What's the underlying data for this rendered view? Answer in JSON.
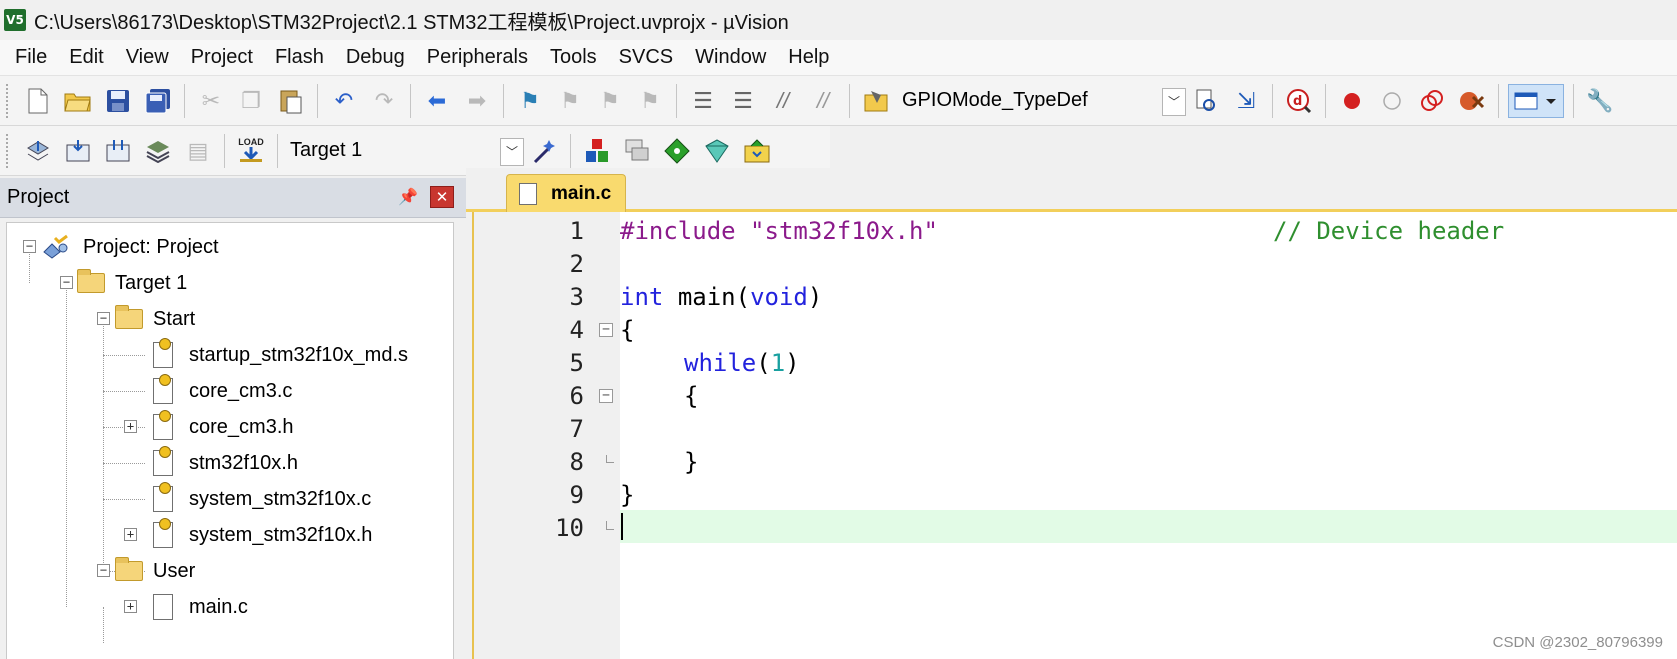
{
  "window": {
    "app_icon_text": "V5",
    "title": "C:\\Users\\86173\\Desktop\\STM32Project\\2.1 STM32工程模板\\Project.uvprojx - µVision"
  },
  "menu": [
    "File",
    "Edit",
    "View",
    "Project",
    "Flash",
    "Debug",
    "Peripherals",
    "Tools",
    "SVCS",
    "Window",
    "Help"
  ],
  "toolbar": {
    "find_combo_value": "GPIOMode_TypeDef",
    "target_combo_value": "Target 1",
    "load_label": "LOAD"
  },
  "project_panel": {
    "title": "Project",
    "root": "Project: Project",
    "target": "Target 1",
    "groups": [
      {
        "name": "Start",
        "files": [
          "startup_stm32f10x_md.s",
          "core_cm3.c",
          "core_cm3.h",
          "stm32f10x.h",
          "system_stm32f10x.c",
          "system_stm32f10x.h"
        ]
      },
      {
        "name": "User",
        "files": [
          "main.c"
        ]
      }
    ]
  },
  "editor": {
    "tab": "main.c",
    "line_numbers": [
      "1",
      "2",
      "3",
      "4",
      "5",
      "6",
      "7",
      "8",
      "9",
      "10"
    ],
    "code": {
      "l1_directive": "#include",
      "l1_string": "\"stm32f10x.h\"",
      "l1_comment": "// Device header",
      "l3_type": "int",
      "l3_name": "main(",
      "l3_param": "void",
      "l3_close": ")",
      "l4": "{",
      "l5_kw": "while",
      "l5_open": "(",
      "l5_num": "1",
      "l5_close": ")",
      "l6": "{",
      "l8": "}",
      "l9": "}"
    }
  },
  "watermark": "CSDN @2302_80796399",
  "colors": {
    "keyword": "#2222dd",
    "directive": "#8b1a8b",
    "string": "#8b1a8b",
    "comment": "#2f8f2f",
    "number": "#19a0a0",
    "current_line": "#e2fbe6",
    "tab": "#f9da6e"
  }
}
